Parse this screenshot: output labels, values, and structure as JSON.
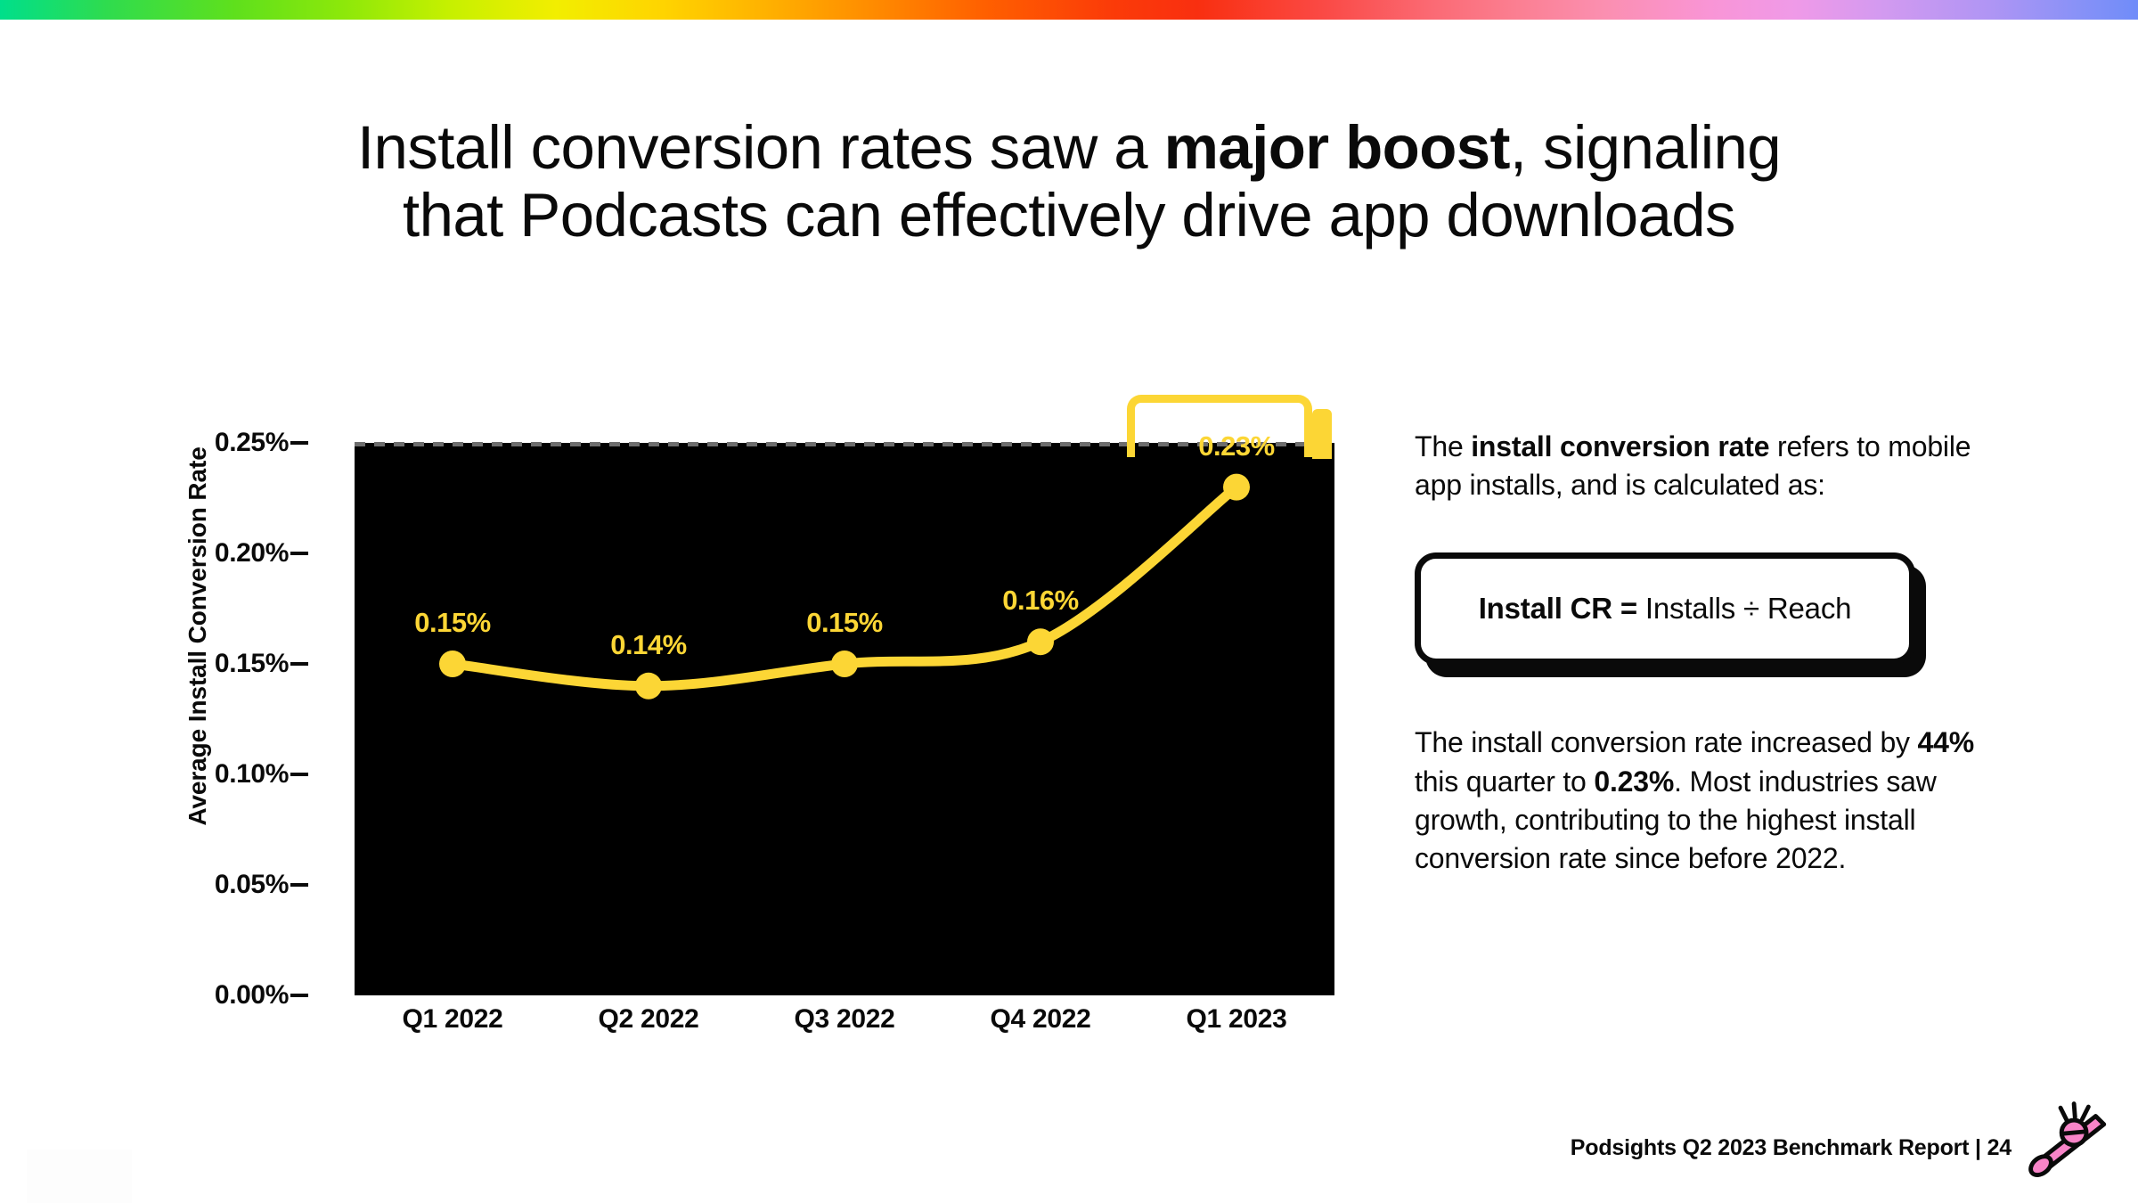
{
  "decor": {
    "rainbow_bar": "gradient-bar",
    "accent_yellow": "#FCD635",
    "ink": "#0A0A0A",
    "plot_bg": "#000000",
    "logo_pink": "#F884C8"
  },
  "title": {
    "line1_pre": "Install conversion rates saw a ",
    "line1_bold": "major boost",
    "line1_post": ", signaling",
    "line2": "that Podcasts can effectively drive app downloads"
  },
  "chart_data": {
    "type": "line",
    "title": "",
    "xlabel": "",
    "ylabel": "Average Install Conversion Rate",
    "categories": [
      "Q1 2022",
      "Q2 2022",
      "Q3 2022",
      "Q4 2022",
      "Q1 2023"
    ],
    "values": [
      0.15,
      0.14,
      0.15,
      0.16,
      0.23
    ],
    "point_labels": [
      "0.15%",
      "0.14%",
      "0.15%",
      "0.16%",
      "0.23%"
    ],
    "ylim": [
      0.0,
      0.25
    ],
    "ytick_values": [
      0.25,
      0.2,
      0.15,
      0.1,
      0.05,
      0.0
    ],
    "ytick_labels": [
      "0.25%",
      "0.20%",
      "0.15%",
      "0.10%",
      "0.05%",
      "0.00%"
    ],
    "series_color": "#FCD635",
    "grid": false,
    "legend": "none",
    "annotation": "highlight-bracket-over-Q1-2023"
  },
  "right_panel": {
    "para1_pre": "The ",
    "para1_bold": "install conversion rate",
    "para1_post": " refers to mobile app installs, and is calculated as:",
    "formula_bold": "Install CR = ",
    "formula_rest": "Installs ÷ Reach",
    "para2_a": "The install conversion rate increased by ",
    "para2_b1": "44%",
    "para2_c": " this quarter to ",
    "para2_b2": "0.23%",
    "para2_d": ". Most industries saw growth, contributing to the highest install conversion rate since before 2022."
  },
  "footer": {
    "text": "Podsights Q2 2023 Benchmark Report | 24",
    "logo": "kazoo-icon"
  }
}
